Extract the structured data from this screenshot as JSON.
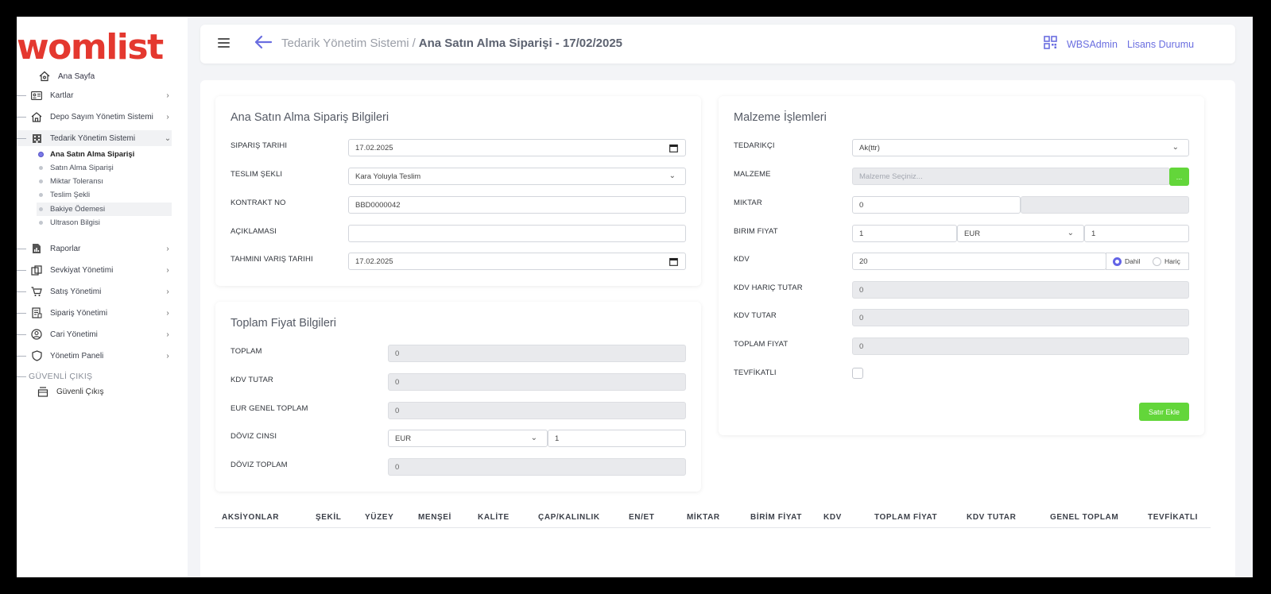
{
  "app": {
    "logo": "womlist"
  },
  "sidebar": {
    "home": "Ana Sayfa",
    "items": [
      {
        "label": "Kartlar"
      },
      {
        "label": "Depo Sayım Yönetim Sistemi"
      },
      {
        "label": "Tedarik Yönetim Sistemi"
      },
      {
        "label": "Raporlar"
      },
      {
        "label": "Sevkiyat Yönetimi"
      },
      {
        "label": "Satış Yönetimi"
      },
      {
        "label": "Sipariş Yönetimi"
      },
      {
        "label": "Cari Yönetimi"
      },
      {
        "label": "Yönetim Paneli"
      }
    ],
    "subitems": [
      {
        "label": "Ana Satın Alma Siparişi"
      },
      {
        "label": "Satın Alma Siparişi"
      },
      {
        "label": "Miktar Toleransı"
      },
      {
        "label": "Teslim Şekli"
      },
      {
        "label": "Bakiye Ödemesi"
      },
      {
        "label": "Ultrason Bilgisi"
      }
    ],
    "section": "GÜVENLİ ÇIKIŞ",
    "logout": "Güvenli Çıkış"
  },
  "header": {
    "breadcrumb_root": "Tedarik Yönetim Sistemi",
    "separator": "/",
    "breadcrumb_current": "Ana Satın Alma Siparişi - 17/02/2025",
    "user": "WBSAdmin",
    "license": "Lisans Durumu"
  },
  "order_info": {
    "title": "Ana Satın Alma Sipariş Bilgileri",
    "fields": [
      {
        "label": "SIPARIŞ TARIHI",
        "value": "17.02.2025"
      },
      {
        "label": "TESLIM ŞEKLI",
        "value": "Kara Yoluyla Teslim"
      },
      {
        "label": "KONTRAKT NO",
        "value": "BBD0000042"
      },
      {
        "label": "AÇIKLAMASI",
        "value": ""
      },
      {
        "label": "TAHMINI VARIŞ TARIHI",
        "value": "17.02.2025"
      }
    ]
  },
  "price_info": {
    "title": "Toplam Fiyat Bilgileri",
    "fields": [
      {
        "label": "TOPLAM",
        "value": "0"
      },
      {
        "label": "KDV TUTAR",
        "value": "0"
      },
      {
        "label": "EUR GENEL TOPLAM",
        "value": "0"
      },
      {
        "label": "DÖVIZ CINSI",
        "value": "EUR",
        "rate": "1"
      },
      {
        "label": "DÖVIZ TOPLAM",
        "value": "0"
      }
    ]
  },
  "material": {
    "title": "Malzeme İşlemleri",
    "supplier_label": "TEDARIKÇI",
    "supplier_value": "Ak(ttr)",
    "material_label": "MALZEME",
    "material_placeholder": "Malzeme Seçiniz...",
    "material_button": "...",
    "qty_label": "MIKTAR",
    "qty_value": "0",
    "unit_price_label": "BIRIM FIYAT",
    "unit_price_value": "1",
    "currency_value": "EUR",
    "currency_rate": "1",
    "vat_label": "KDV",
    "vat_value": "20",
    "vat_included": "Dahil",
    "vat_excluded": "Hariç",
    "excl_total_label": "KDV HARIÇ TUTAR",
    "excl_total_value": "0",
    "vat_amount_label": "KDV TUTAR",
    "vat_amount_value": "0",
    "total_label": "TOPLAM FIYAT",
    "total_value": "0",
    "tevfikatli_label": "TEVFİKATLI",
    "add_button": "Satır Ekle"
  },
  "table": {
    "columns": [
      "AKSİYONLAR",
      "ŞEKİL",
      "YÜZEY",
      "MENŞEİ",
      "KALİTE",
      "ÇAP/KALINLIK",
      "EN/ET",
      "MİKTAR",
      "BİRİM FİYAT",
      "KDV",
      "TOPLAM FİYAT",
      "KDV TUTAR",
      "GENEL TOPLAM",
      "TEVFİKATLI"
    ]
  },
  "colors": {
    "accent": "#6a6ee0",
    "green": "#63d63a",
    "logo": "#e4382f"
  }
}
